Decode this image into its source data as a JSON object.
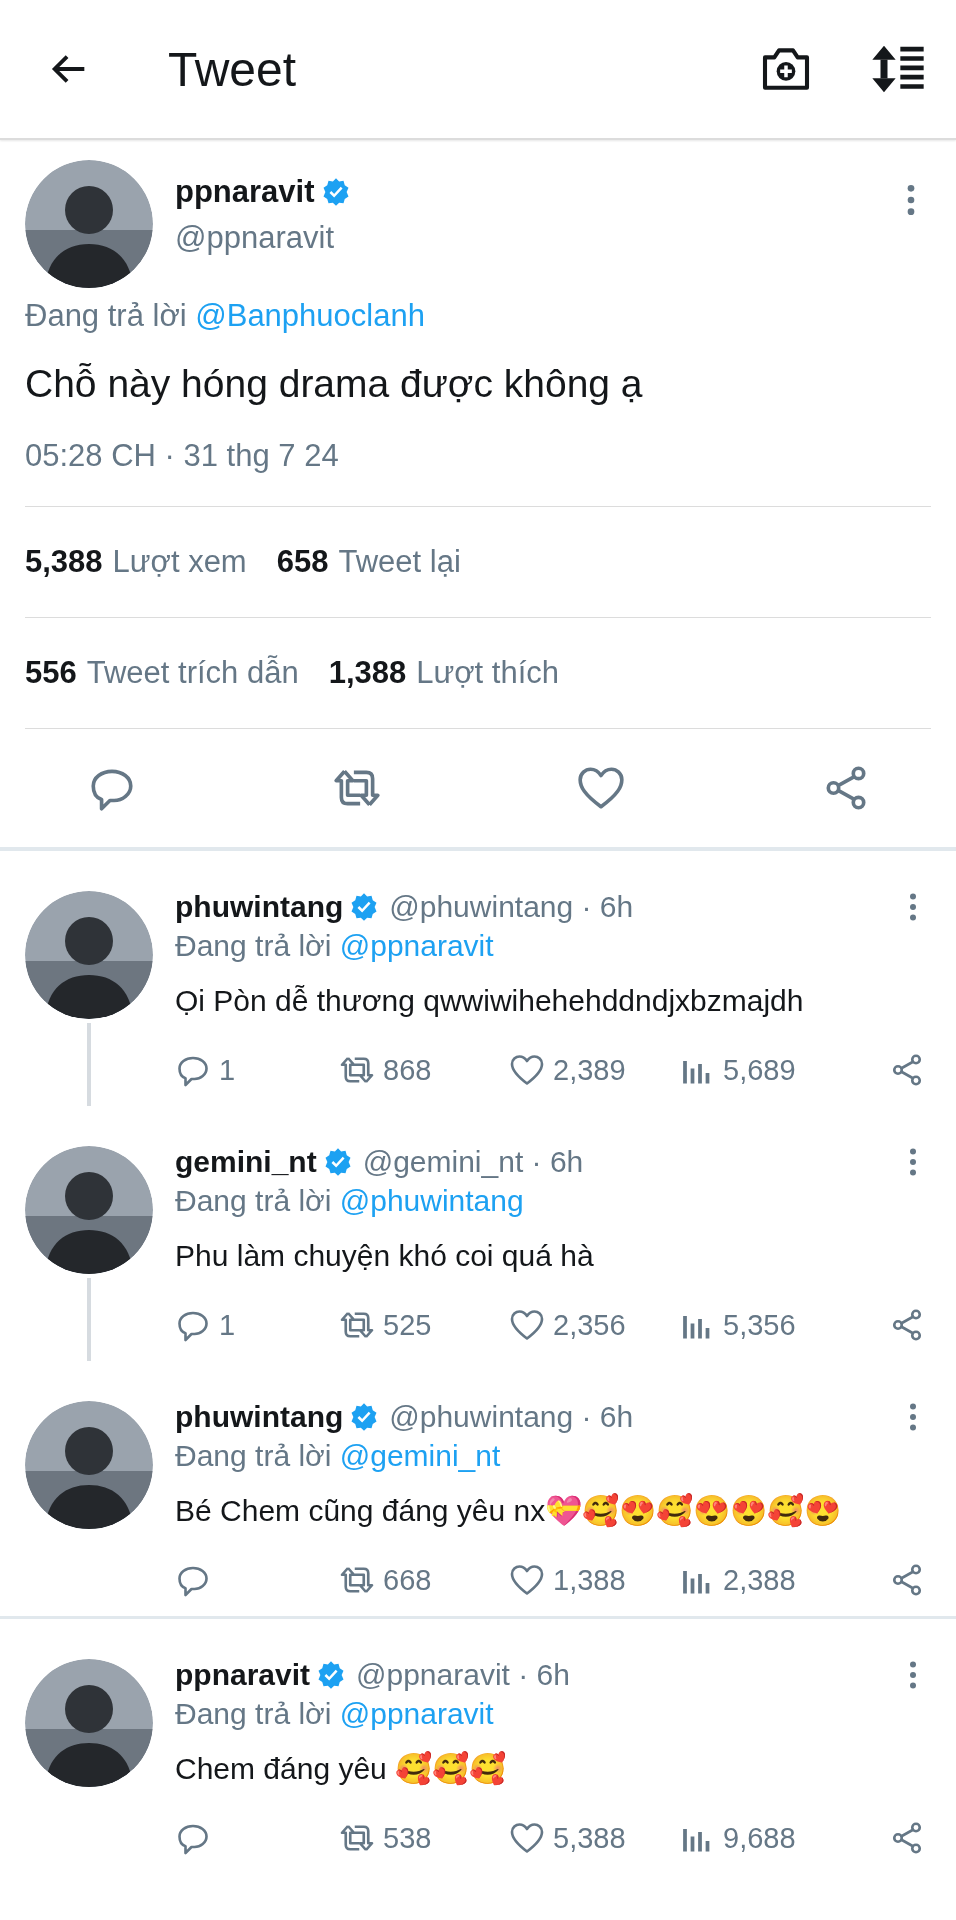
{
  "header": {
    "title": "Tweet"
  },
  "tweet": {
    "name": "ppnaravit",
    "verified": true,
    "handle": "@ppnaravit",
    "reply_prefix": "Đang trả lời",
    "reply_to": "@Banphuoclanh",
    "text": "Chỗ này hóng drama được không ạ",
    "timestamp": "05:28 CH · 31 thg 7 24",
    "stats": [
      {
        "count": "5,388",
        "unit": "Lượt xem"
      },
      {
        "count": "658",
        "unit": "Tweet lại"
      },
      {
        "count": "556",
        "unit": "Tweet trích dẫn"
      },
      {
        "count": "1,388",
        "unit": "Lượt thích"
      }
    ]
  },
  "replies": [
    {
      "name": "phuwintang",
      "verified": true,
      "handle": "@phuwintang",
      "time": "· 6h",
      "reply_prefix": "Đang trả lời",
      "reply_to": "@ppnaravit",
      "text": "Ọi Pòn dễ thương qwwiwihehehddndjxbzmajdh",
      "replies": "1",
      "retweets": "868",
      "likes": "2,389",
      "views": "5,689",
      "thread_next": true
    },
    {
      "name": "gemini_nt",
      "verified": true,
      "handle": "@gemini_nt",
      "time": "· 6h",
      "reply_prefix": "Đang trả lời",
      "reply_to": "@phuwintang",
      "text": "Phu làm chuyện khó coi quá hà",
      "replies": "1",
      "retweets": "525",
      "likes": "2,356",
      "views": "5,356",
      "thread_next": true
    },
    {
      "name": "phuwintang",
      "verified": true,
      "handle": "@phuwintang",
      "time": "· 6h",
      "reply_prefix": "Đang trả lời",
      "reply_to": "@gemini_nt",
      "text": "Bé Chem cũng đáng yêu nx💝🥰😍🥰😍😍🥰😍",
      "retweets": "668",
      "likes": "1,388",
      "views": "2,388",
      "thread_next": false
    },
    {
      "name": "ppnaravit",
      "verified": true,
      "handle": "@ppnaravit",
      "time": "· 6h",
      "reply_prefix": "Đang trả lời",
      "reply_to": "@ppnaravit",
      "text": "Chem đáng yêu 🥰🥰🥰",
      "retweets": "538",
      "likes": "5,388",
      "views": "9,688",
      "thread_next": false
    }
  ]
}
